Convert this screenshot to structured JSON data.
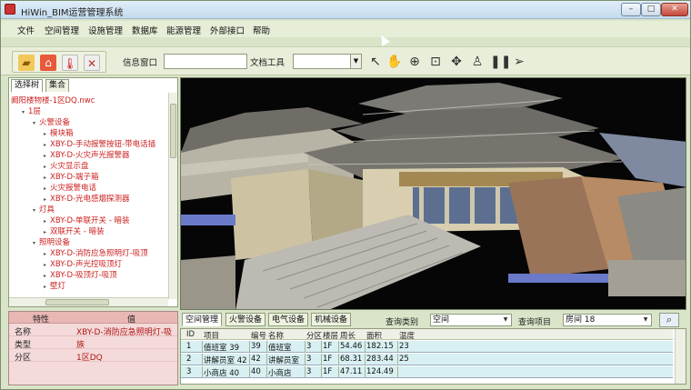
{
  "window": {
    "title": "HiWin_BIM运营管理系统"
  },
  "menu": [
    "文件",
    "空间管理",
    "设施管理",
    "数据库",
    "能源管理",
    "外部接口",
    "帮助"
  ],
  "toolbar": {
    "info_label": "信息窗口",
    "info_value": "",
    "doc_label": "文档工具",
    "doc_value": ""
  },
  "left_tabs": [
    "选择树",
    "集合"
  ],
  "tree": [
    {
      "text": "阚阳楼物楼-1区DQ.nwc",
      "level": 0,
      "exp": ""
    },
    {
      "text": "1层",
      "level": 1,
      "exp": "-"
    },
    {
      "text": "火警设备",
      "level": 2,
      "exp": "-"
    },
    {
      "text": "模块箱",
      "level": 3,
      "exp": "+"
    },
    {
      "text": "XBY-D-手动报警按钮-带电话插",
      "level": 3,
      "exp": "+"
    },
    {
      "text": "XBY-D-火灾声光报警器",
      "level": 3,
      "exp": "+"
    },
    {
      "text": "火灾显示盘",
      "level": 3,
      "exp": "+"
    },
    {
      "text": "XBY-D-端子箱",
      "level": 3,
      "exp": "+"
    },
    {
      "text": "火灾报警电话",
      "level": 3,
      "exp": "+"
    },
    {
      "text": "XBY-D-光电感烟探测器",
      "level": 3,
      "exp": "+"
    },
    {
      "text": "灯具",
      "level": 2,
      "exp": "-"
    },
    {
      "text": "XBY-D-单联开关 - 暗装",
      "level": 3,
      "exp": "+"
    },
    {
      "text": "双联开关 - 暗装",
      "level": 3,
      "exp": "+"
    },
    {
      "text": "照明设备",
      "level": 2,
      "exp": "-"
    },
    {
      "text": "XBY-D-消防应急照明灯-吸顶",
      "level": 3,
      "exp": "+"
    },
    {
      "text": "XBY-D-声光控吸顶灯",
      "level": 3,
      "exp": "+"
    },
    {
      "text": "XBY-D-吸顶灯-吸顶",
      "level": 3,
      "exp": "+"
    },
    {
      "text": "壁灯",
      "level": 3,
      "exp": "+"
    }
  ],
  "properties": {
    "header_key": "特性",
    "header_val": "值",
    "rows": [
      {
        "k": "名称",
        "v": "XBY-D-消防应急照明灯-吸"
      },
      {
        "k": "类型",
        "v": "族"
      },
      {
        "k": "分区",
        "v": "1区DQ"
      }
    ]
  },
  "bottom_tabs": [
    "空间管理",
    "火警设备",
    "电气设备",
    "机械设备"
  ],
  "query": {
    "type_label": "查询类别",
    "type_value": "空间",
    "item_label": "查询项目",
    "item_value": "房间 18"
  },
  "grid": {
    "headers": [
      "ID",
      "项目",
      "编号",
      "名称",
      "分区",
      "楼层",
      "周长",
      "面积",
      "温度"
    ],
    "rows": [
      [
        "1",
        "值班室 39",
        "39",
        "值班室",
        "3",
        "1F",
        "54.46",
        "182.15",
        "23"
      ],
      [
        "2",
        "讲解员室 42",
        "42",
        "讲解员室",
        "3",
        "1F",
        "68.31",
        "283.44",
        "25"
      ],
      [
        "3",
        "小商店 40",
        "40",
        "小商店",
        "3",
        "1F",
        "47.11",
        "124.49",
        ""
      ]
    ]
  },
  "colors": {
    "window_bg": "#d9e4c8",
    "tree_text": "#cc1f1f",
    "property_bg": "#f4dada",
    "grid_row_bg": "#d8f0f2"
  },
  "icons": [
    "folder-open-icon",
    "home-icon",
    "thermometer-icon",
    "tools-icon",
    "pointer-icon",
    "hand-pan-icon",
    "zoom-icon",
    "zoom-window-icon",
    "orbit-icon",
    "walk-icon",
    "footsteps-icon",
    "select-arrow-icon",
    "search-icon"
  ]
}
